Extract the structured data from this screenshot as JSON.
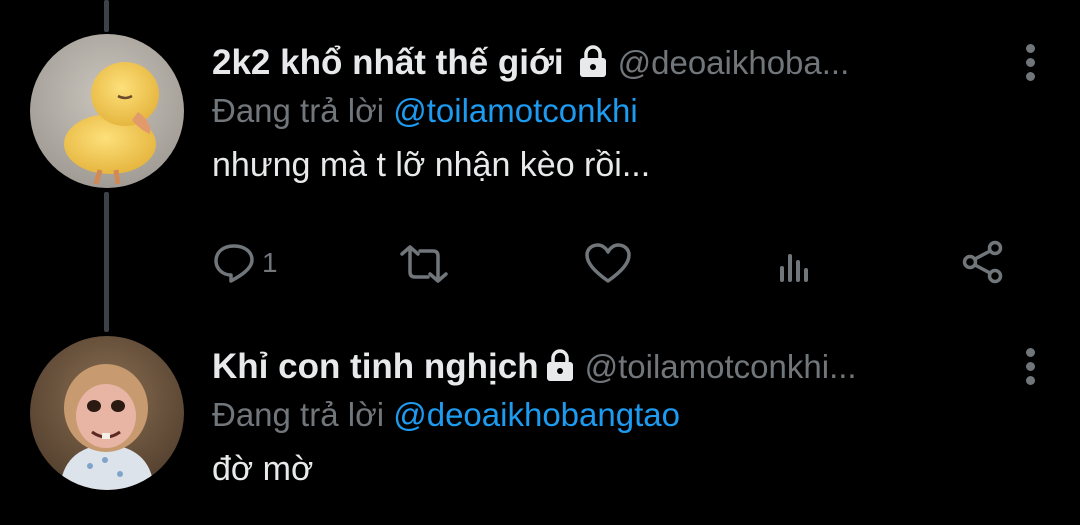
{
  "tweets": [
    {
      "name": "2k2 khổ nhất thế giới",
      "handle": "@deoaikhoba...",
      "reply_prefix": "Đang trả lời",
      "reply_to": "@toilamotconkhi",
      "text": "nhưng mà t lỡ nhận kèo rồi...",
      "reply_count": "1",
      "avatar": "duckling-photo"
    },
    {
      "name": "Khỉ con tinh nghịch",
      "handle": "@toilamotconkhi...",
      "reply_prefix": "Đang trả lời",
      "reply_to": "@deoaikhobangtao",
      "text": "đờ mờ",
      "avatar": "baby-monkey-photo"
    }
  ],
  "icons": [
    "lock-icon",
    "more-options-icon",
    "reply-icon",
    "retweet-icon",
    "like-icon",
    "analytics-icon",
    "share-icon"
  ],
  "colors": {
    "background": "#000000",
    "text": "#e7e9ea",
    "secondary": "#71767b",
    "link": "#1d9bf0",
    "thread_line": "#3d4248"
  }
}
